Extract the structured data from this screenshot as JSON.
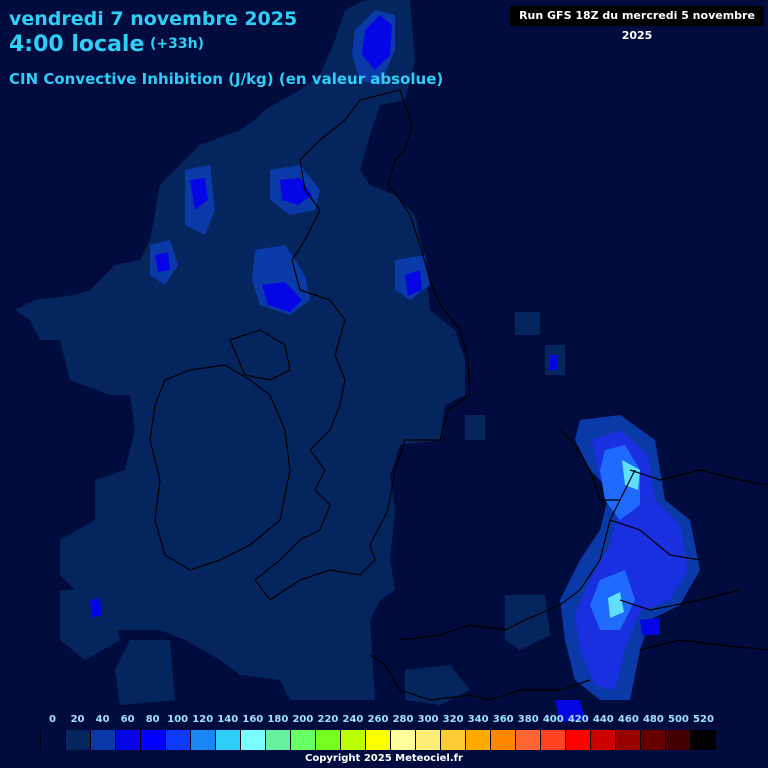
{
  "header": {
    "date": "vendredi 7 novembre 2025",
    "time": "4:00 locale",
    "offset": "(+33h)",
    "parameter": "CIN Convective Inhibition (J/kg) (en valeur absolue)",
    "run": "Run GFS 18Z du mercredi 5 novembre 2025"
  },
  "legend": {
    "ticks": [
      "0",
      "20",
      "40",
      "60",
      "80",
      "100",
      "120",
      "140",
      "160",
      "180",
      "200",
      "220",
      "240",
      "260",
      "280",
      "300",
      "320",
      "340",
      "360",
      "380",
      "400",
      "420",
      "440",
      "460",
      "480",
      "500",
      "520"
    ],
    "colors": [
      "#000c3e",
      "#05255e",
      "#0a3aa8",
      "#0505e6",
      "#0000ff",
      "#0d3cff",
      "#1a86f5",
      "#2ecff7",
      "#7affff",
      "#66f0a0",
      "#66ff66",
      "#77ff22",
      "#bbff00",
      "#ffff00",
      "#ffff99",
      "#ffee77",
      "#ffcc33",
      "#ffaa00",
      "#ff8800",
      "#ff6633",
      "#ff4422",
      "#ff0000",
      "#cc0000",
      "#990000",
      "#660000",
      "#440000",
      "#000000"
    ]
  },
  "map": {
    "background": "#000c3e",
    "low_cin_color": "#05255e",
    "mid_cin_color": "#1a2fd0",
    "high_cin_color": "#1f6bff",
    "peak_cin_color": "#5fe0ff",
    "coastline_color": "#000000"
  },
  "footer": {
    "copyright": "Copyright 2025 Meteociel.fr"
  }
}
